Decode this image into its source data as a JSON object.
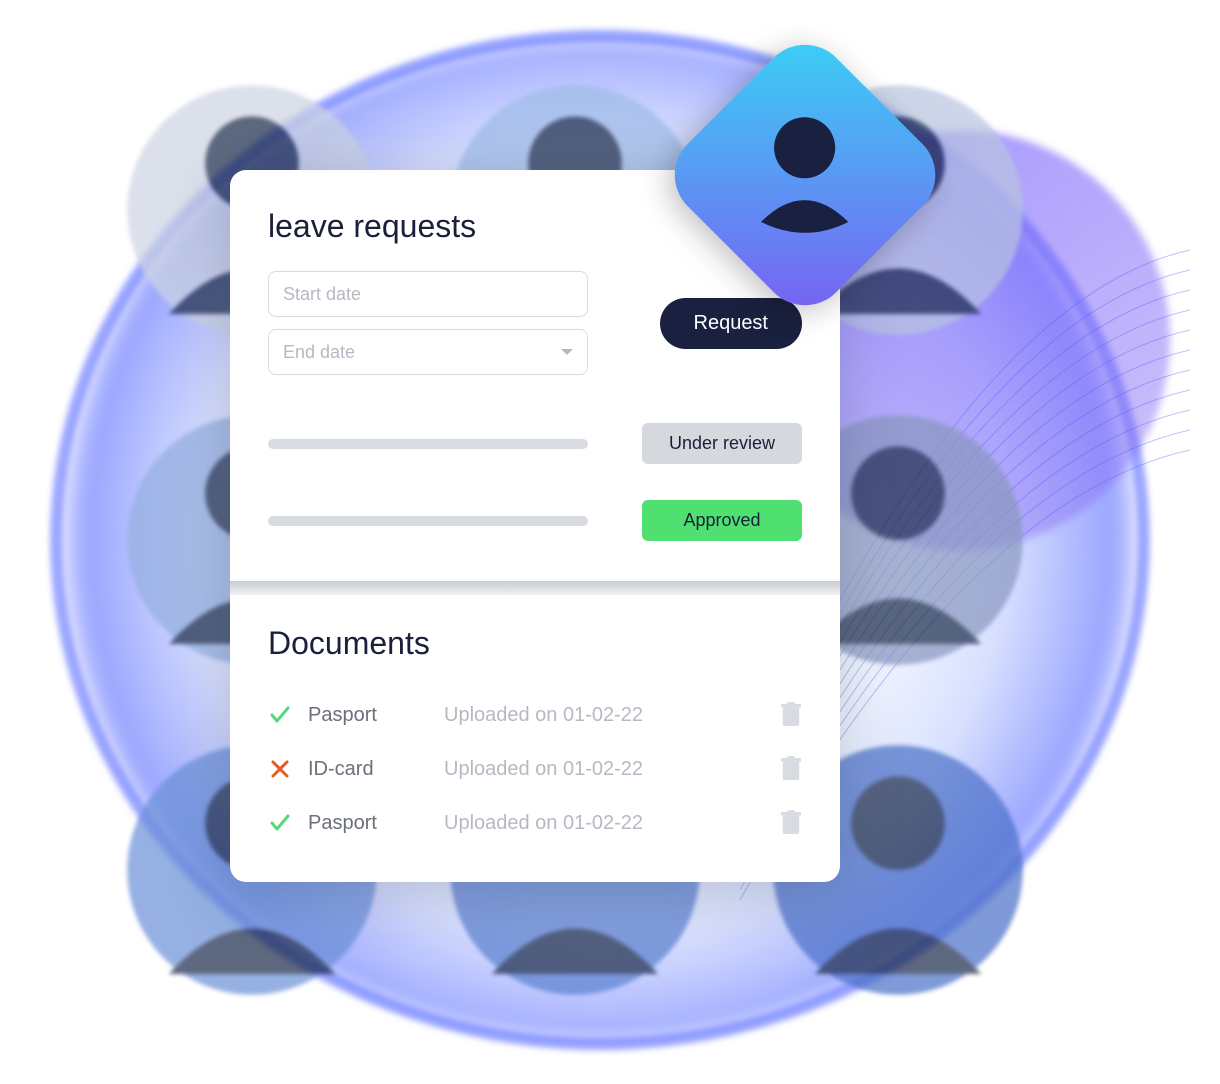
{
  "leave": {
    "title": "leave requests",
    "start_placeholder": "Start date",
    "end_placeholder": "End date",
    "request_label": "Request",
    "statuses": [
      {
        "label": "Under review",
        "class": "chip-review"
      },
      {
        "label": "Approved",
        "class": "chip-approved"
      }
    ]
  },
  "documents": {
    "title": "Documents",
    "items": [
      {
        "ok": true,
        "name": "Pasport",
        "uploaded": "Uploaded on 01-02-22"
      },
      {
        "ok": false,
        "name": "ID-card",
        "uploaded": "Uploaded on 01-02-22"
      },
      {
        "ok": true,
        "name": "Pasport",
        "uploaded": "Uploaded on 01-02-22"
      }
    ]
  },
  "colors": {
    "approved": "#4fe071",
    "review": "#d5d8dd",
    "navy": "#1a2140",
    "ok": "#57d97a",
    "err": "#ea5a20"
  }
}
